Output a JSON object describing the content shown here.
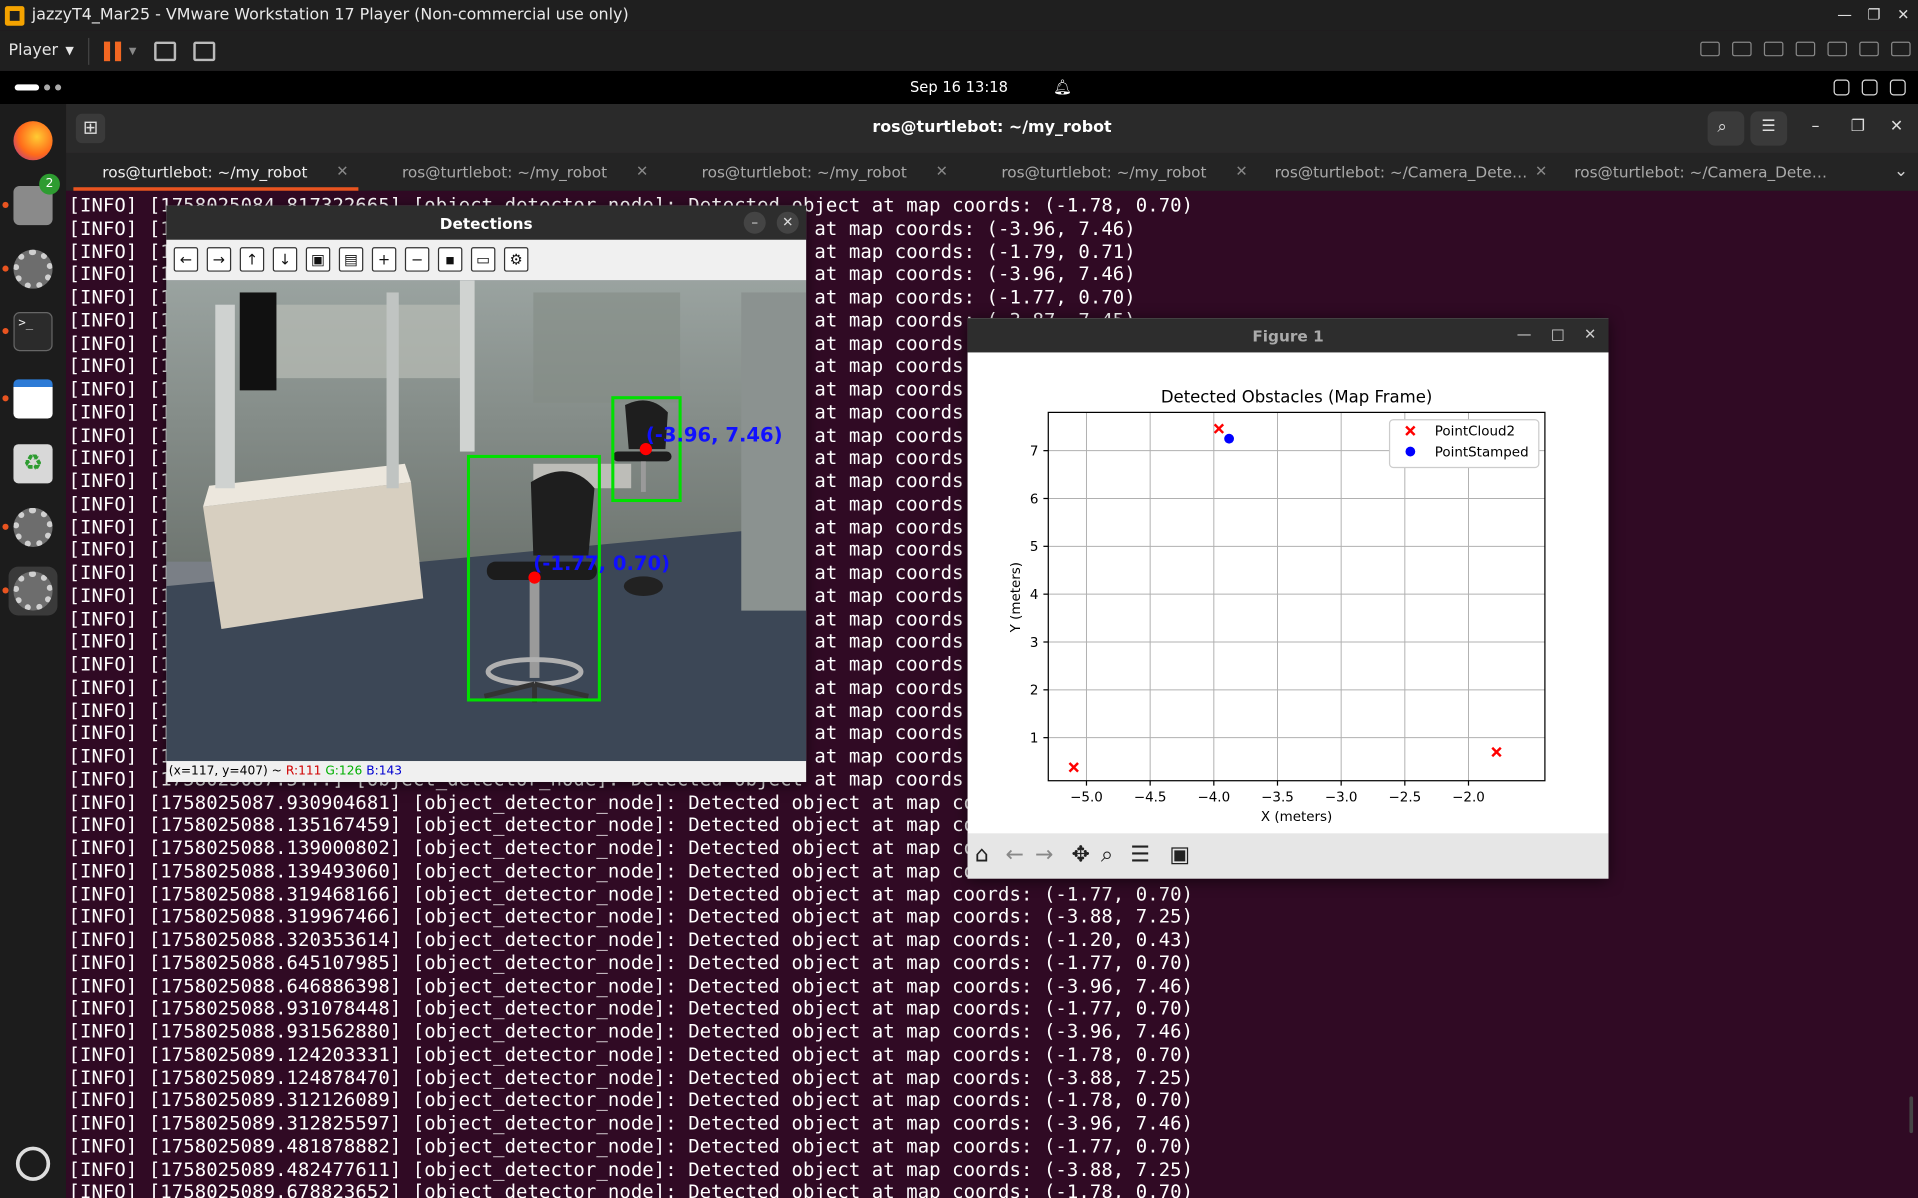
{
  "vmware": {
    "title": "jazzyT4_Mar25 - VMware Workstation 17 Player (Non-commercial use only)",
    "player_label": "Player",
    "window_controls": [
      "—",
      "❐",
      "✕"
    ]
  },
  "topbar": {
    "datetime": "Sep 16  13:18"
  },
  "dock": {
    "files_badge": "2"
  },
  "terminal": {
    "title": "ros@turtlebot: ~/my_robot",
    "tabs": [
      "ros@turtlebot: ~/my_robot",
      "ros@turtlebot: ~/my_robot",
      "ros@turtlebot: ~/my_robot",
      "ros@turtlebot: ~/my_robot",
      "ros@turtlebot: ~/Camera_Detecti...",
      "ros@turtlebot: ~/Camera_Detecti..."
    ],
    "log_lines": [
      "[INFO] [1758025084.817322665] [object_detector_node]: Detected object at map coords: (-1.78, 0.70)",
      "[INFO] [1758025085.0...] [object_detector_node]: Detected object at map coords: (-3.96, 7.46)",
      "[INFO] [1758025085.1...] [object_detector_node]: Detected object at map coords: (-1.79, 0.71)",
      "[INFO] [1758025085.1...] [object_detector_node]: Detected object at map coords: (-3.96, 7.46)",
      "[INFO] [1758025085.3...] [object_detector_node]: Detected object at map coords: (-1.77, 0.70)",
      "[INFO] [1758025085.3...] [object_detector_node]: Detected object at map coords: (-3.87, 7.45)",
      "[INFO] [1758025085.5...] [object_detector_node]: Detected object at map coords",
      "[INFO] [1758025085.5...] [object_detector_node]: Detected object at map coords",
      "[INFO] [1758025085.7...] [object_detector_node]: Detected object at map coords",
      "[INFO] [1758025085.7...] [object_detector_node]: Detected object at map coords",
      "[INFO] [1758025085.9...] [object_detector_node]: Detected object at map coords",
      "[INFO] [1758025085.9...] [object_detector_node]: Detected object at map coords",
      "[INFO] [1758025086.1...] [object_detector_node]: Detected object at map coords",
      "[INFO] [1758025086.1...] [object_detector_node]: Detected object at map coords",
      "[INFO] [1758025086.3...] [object_detector_node]: Detected object at map coords",
      "[INFO] [1758025086.3...] [object_detector_node]: Detected object at map coords",
      "[INFO] [1758025086.5...] [object_detector_node]: Detected object at map coords",
      "[INFO] [1758025086.5...] [object_detector_node]: Detected object at map coords",
      "[INFO] [1758025086.7...] [object_detector_node]: Detected object at map coords",
      "[INFO] [1758025086.7...] [object_detector_node]: Detected object at map coords",
      "[INFO] [1758025086.9...] [object_detector_node]: Detected object at map coords",
      "[INFO] [1758025086.9...] [object_detector_node]: Detected object at map coords",
      "[INFO] [1758025087.1...] [object_detector_node]: Detected object at map coords",
      "[INFO] [1758025087.1...] [object_detector_node]: Detected object at map coords",
      "[INFO] [1758025087.3...] [object_detector_node]: Detected object at map coords",
      "[INFO] [1758025087.5...] [object_detector_node]: Detected object at map coords",
      "[INFO] [1758025087.930904681] [object_detector_node]: Detected object at map coords",
      "[INFO] [1758025088.135167459] [object_detector_node]: Detected object at map coords",
      "[INFO] [1758025088.139000802] [object_detector_node]: Detected object at map coords",
      "[INFO] [1758025088.139493060] [object_detector_node]: Detected object at map coords",
      "[INFO] [1758025088.319468166] [object_detector_node]: Detected object at map coords: (-1.77, 0.70)",
      "[INFO] [1758025088.319967466] [object_detector_node]: Detected object at map coords: (-3.88, 7.25)",
      "[INFO] [1758025088.320353614] [object_detector_node]: Detected object at map coords: (-1.20, 0.43)",
      "[INFO] [1758025088.645107985] [object_detector_node]: Detected object at map coords: (-1.77, 0.70)",
      "[INFO] [1758025088.646886398] [object_detector_node]: Detected object at map coords: (-3.96, 7.46)",
      "[INFO] [1758025088.931078448] [object_detector_node]: Detected object at map coords: (-1.77, 0.70)",
      "[INFO] [1758025088.931562880] [object_detector_node]: Detected object at map coords: (-3.96, 7.46)",
      "[INFO] [1758025089.124203331] [object_detector_node]: Detected object at map coords: (-1.78, 0.70)",
      "[INFO] [1758025089.124878470] [object_detector_node]: Detected object at map coords: (-3.88, 7.25)",
      "[INFO] [1758025089.312126089] [object_detector_node]: Detected object at map coords: (-1.78, 0.70)",
      "[INFO] [1758025089.312825597] [object_detector_node]: Detected object at map coords: (-3.96, 7.46)",
      "[INFO] [1758025089.481878882] [object_detector_node]: Detected object at map coords: (-1.77, 0.70)",
      "[INFO] [1758025089.482477611] [object_detector_node]: Detected object at map coords: (-3.88, 7.25)",
      "[INFO] [1758025089.678823652] [object_detector_node]: Detected object at map coords: (-1.78, 0.70)"
    ]
  },
  "detections": {
    "title": "Detections",
    "label_far": "(-3.96, 7.46)",
    "label_near": "(-1.77, 0.70)",
    "status_pos": "(x=117, y=407) ~ ",
    "status_r": "R:111",
    "status_g": "G:126",
    "status_b": "B:143",
    "box_color": "#00e000",
    "label_color": "#1010ff"
  },
  "figure": {
    "title": "Figure 1",
    "window_controls": [
      "—",
      "□",
      "✕"
    ]
  },
  "chart_data": {
    "type": "scatter",
    "title": "Detected Obstacles (Map Frame)",
    "xlabel": "X (meters)",
    "ylabel": "Y (meters)",
    "xlim": [
      -5.3,
      -1.4
    ],
    "ylim": [
      0.1,
      7.8
    ],
    "xticks": [
      -5.0,
      -4.5,
      -4.0,
      -3.5,
      -3.0,
      -2.5,
      -2.0
    ],
    "xtick_labels": [
      "−5.0",
      "−4.5",
      "−4.0",
      "−3.5",
      "−3.0",
      "−2.5",
      "−2.0"
    ],
    "yticks": [
      1,
      2,
      3,
      4,
      5,
      6,
      7
    ],
    "ytick_labels": [
      "1",
      "2",
      "3",
      "4",
      "5",
      "6",
      "7"
    ],
    "grid": true,
    "legend_position": "top-right",
    "series": [
      {
        "name": "PointCloud2",
        "marker": "x",
        "color": "#ff0000",
        "points": [
          [
            -3.96,
            7.46
          ],
          [
            -5.1,
            0.38
          ],
          [
            -1.78,
            0.7
          ]
        ]
      },
      {
        "name": "PointStamped",
        "marker": "o",
        "color": "#0000ff",
        "points": [
          [
            -3.88,
            7.25
          ]
        ]
      }
    ]
  }
}
